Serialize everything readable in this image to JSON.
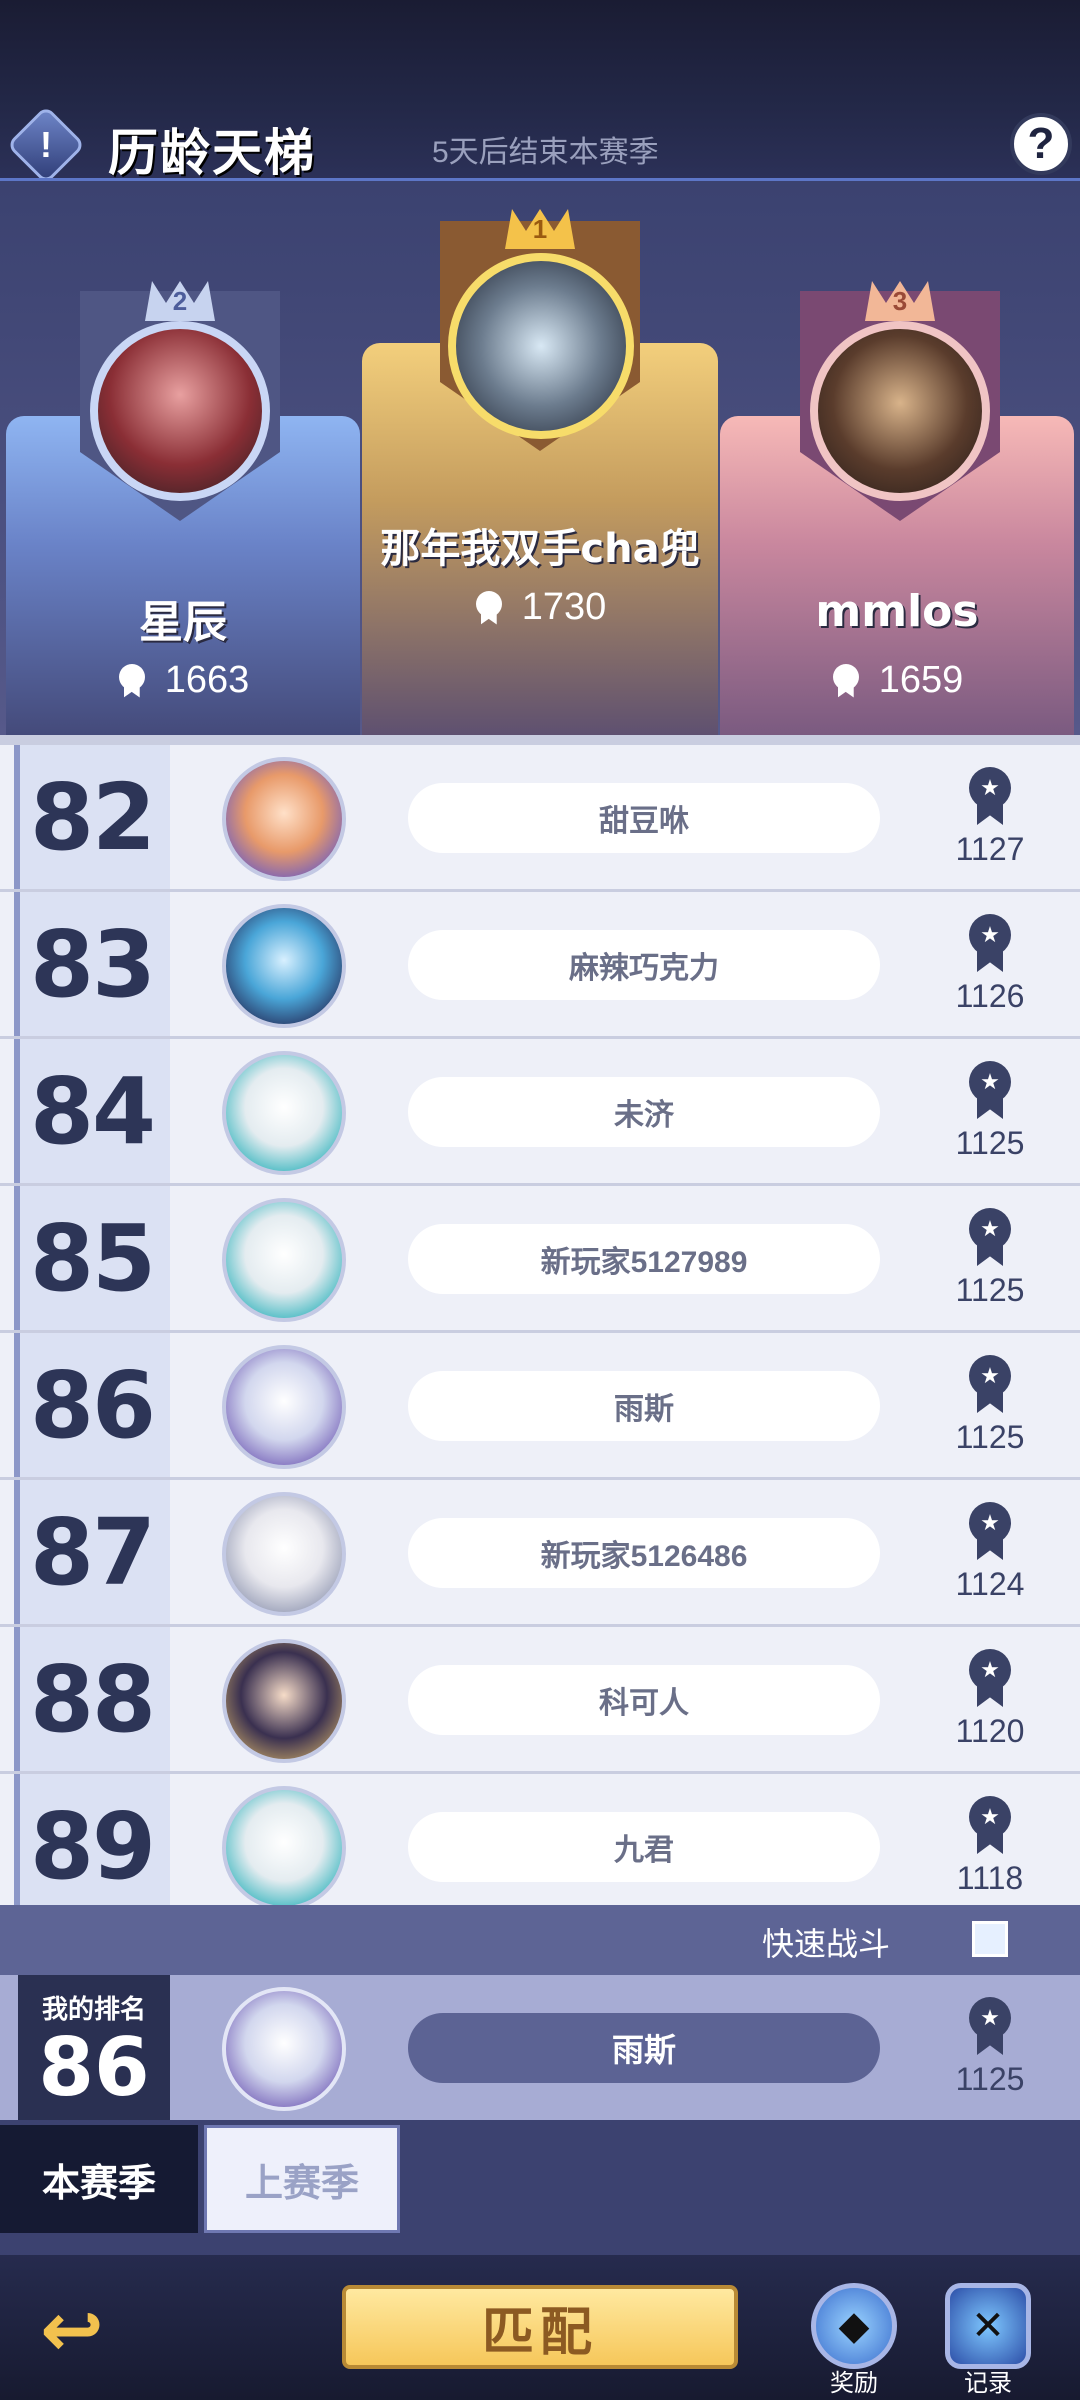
{
  "header": {
    "title": "历龄天梯",
    "season_note": "5天后结束本赛季",
    "info_icon": "!",
    "help_icon": "?"
  },
  "podium": {
    "first": {
      "rank": "1",
      "name": "那年我双手cha兜",
      "score": "1730"
    },
    "second": {
      "rank": "2",
      "name": "星辰",
      "score": "1663"
    },
    "third": {
      "rank": "3",
      "name": "mmlos",
      "score": "1659"
    }
  },
  "ranking": [
    {
      "rank": "82",
      "name": "甜豆咻",
      "score": "1127"
    },
    {
      "rank": "83",
      "name": "麻辣巧克力",
      "score": "1126"
    },
    {
      "rank": "84",
      "name": "未济",
      "score": "1125"
    },
    {
      "rank": "85",
      "name": "新玩家5127989",
      "score": "1125"
    },
    {
      "rank": "86",
      "name": "雨斯",
      "score": "1125"
    },
    {
      "rank": "87",
      "name": "新玩家5126486",
      "score": "1124"
    },
    {
      "rank": "88",
      "name": "科可人",
      "score": "1120"
    },
    {
      "rank": "89",
      "name": "九君",
      "score": "1118"
    }
  ],
  "quick_battle": {
    "label": "快速战斗",
    "checked": false
  },
  "my_rank": {
    "caption": "我的排名",
    "rank": "86",
    "name": "雨斯",
    "score": "1125"
  },
  "tabs": {
    "current": "本赛季",
    "previous": "上赛季"
  },
  "bottom": {
    "match_label": "匹配",
    "reward_label": "奖励",
    "record_label": "记录",
    "back_icon": "↩"
  },
  "icons": {
    "medal": "medal-icon",
    "star": "★"
  },
  "colors": {
    "accent_gold": "#f6c75a",
    "dark_navy": "#2d3557",
    "pill_active": "#5c6394"
  }
}
